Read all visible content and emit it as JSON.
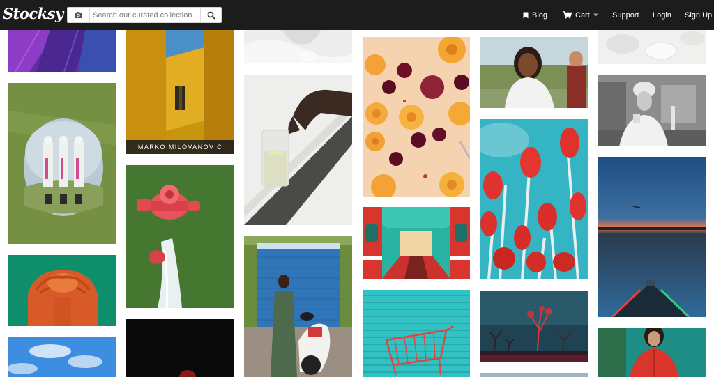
{
  "app": {
    "logo_text": "Stocksy"
  },
  "search": {
    "placeholder": "Search our curated collection",
    "value": ""
  },
  "nav": {
    "blog": "Blog",
    "cart": "Cart",
    "support": "Support",
    "login": "Login",
    "signup": "Sign Up"
  },
  "gallery": {
    "credit_label": "MARKO MILOVANOVIĆ"
  },
  "colors": {
    "topbar": "#1c1c1c",
    "background": "#ffffff"
  }
}
